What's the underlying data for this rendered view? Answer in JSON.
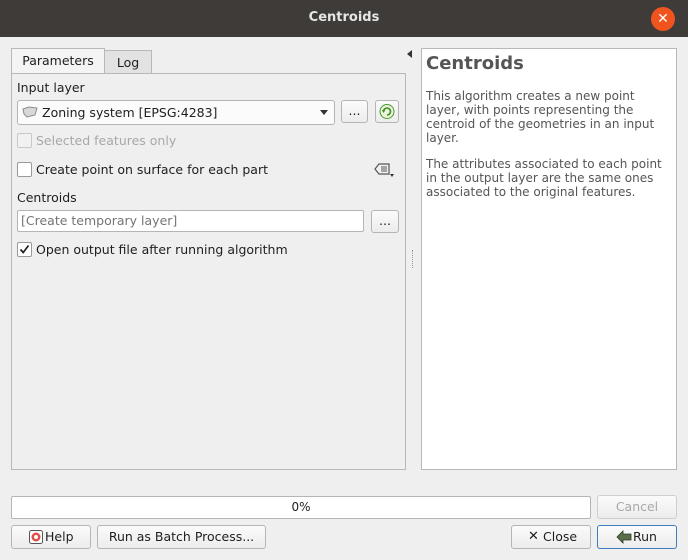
{
  "window": {
    "title": "Centroids",
    "close_glyph": "✕"
  },
  "tabs": [
    {
      "label": "Parameters"
    },
    {
      "label": "Log"
    }
  ],
  "parameters": {
    "input_layer_label": "Input layer",
    "input_layer_value": "Zoning system [EPSG:4283]",
    "browse_label": "...",
    "selected_only_label": "Selected features only",
    "point_on_surface_label": "Create point on surface for each part",
    "centroids_label": "Centroids",
    "output_placeholder": "[Create temporary layer]",
    "output_browse_label": "...",
    "open_output_label": "Open output file after running algorithm"
  },
  "help": {
    "title": "Centroids",
    "para1": "This algorithm creates a new point layer, with points representing the centroid of the geometries in an input layer.",
    "para2": "The attributes associated to each point in the output layer are the same ones associated to the original features."
  },
  "progress": {
    "text": "0%"
  },
  "buttons": {
    "cancel": "Cancel",
    "help": "Help",
    "batch": "Run as Batch Process...",
    "close": "Close",
    "run": "Run"
  },
  "colors": {
    "titlebar": "#3e3b38",
    "close_accent": "#f0541e",
    "run_border": "#3d7ebf"
  }
}
